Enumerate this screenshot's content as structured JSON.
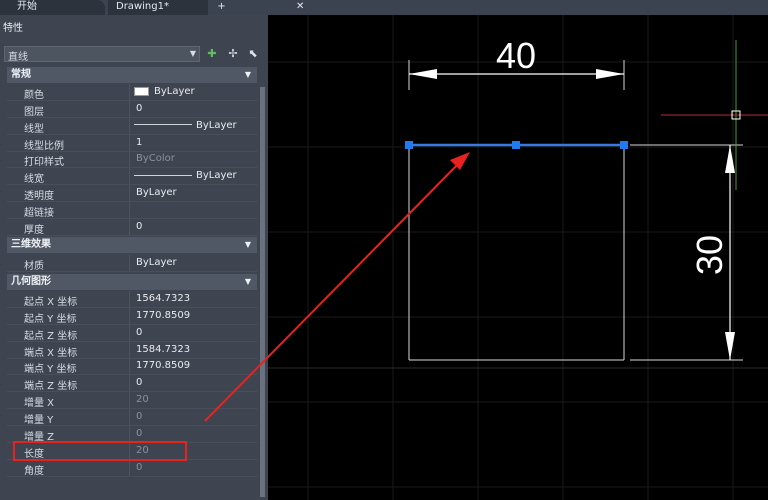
{
  "tabs": {
    "start": "开始",
    "drawing": "Drawing1*",
    "close_glyph": "✕",
    "new_glyph": "+"
  },
  "palette": {
    "title": "特性",
    "object_type": "直线",
    "icons": [
      "quick-select-icon",
      "pick-objects-icon",
      "toggle-pickadd-icon"
    ],
    "sections": {
      "general": "常规",
      "threed": "三维效果",
      "geometry": "几何图形"
    },
    "general_rows": [
      {
        "label": "颜色",
        "value": "ByLayer"
      },
      {
        "label": "图层",
        "value": "0"
      },
      {
        "label": "线型",
        "value": "ByLayer"
      },
      {
        "label": "线型比例",
        "value": "1"
      },
      {
        "label": "打印样式",
        "value": "ByColor"
      },
      {
        "label": "线宽",
        "value": "ByLayer"
      },
      {
        "label": "透明度",
        "value": "ByLayer"
      },
      {
        "label": "超链接",
        "value": ""
      },
      {
        "label": "厚度",
        "value": "0"
      }
    ],
    "threed_rows": [
      {
        "label": "材质",
        "value": "ByLayer"
      }
    ],
    "geometry_rows": [
      {
        "label": "起点 X 坐标",
        "value": "1564.7323"
      },
      {
        "label": "起点 Y 坐标",
        "value": "1770.8509"
      },
      {
        "label": "起点 Z 坐标",
        "value": "0"
      },
      {
        "label": "端点 X 坐标",
        "value": "1584.7323"
      },
      {
        "label": "端点 Y 坐标",
        "value": "1770.8509"
      },
      {
        "label": "端点 Z 坐标",
        "value": "0"
      },
      {
        "label": "增量 X",
        "value": "20"
      },
      {
        "label": "增量 Y",
        "value": "0"
      },
      {
        "label": "增量 Z",
        "value": "0"
      },
      {
        "label": "长度",
        "value": "20"
      },
      {
        "label": "角度",
        "value": "0"
      }
    ]
  },
  "drawing": {
    "dim_horizontal": "40",
    "dim_vertical": "30",
    "colors": {
      "selected_line": "#3a7ae0",
      "grip": "#1e7bf0",
      "annotation": "#e8231f",
      "dimension": "#ffffff",
      "y_axis": "#4c9a2a",
      "x_axis": "#b03030"
    }
  }
}
